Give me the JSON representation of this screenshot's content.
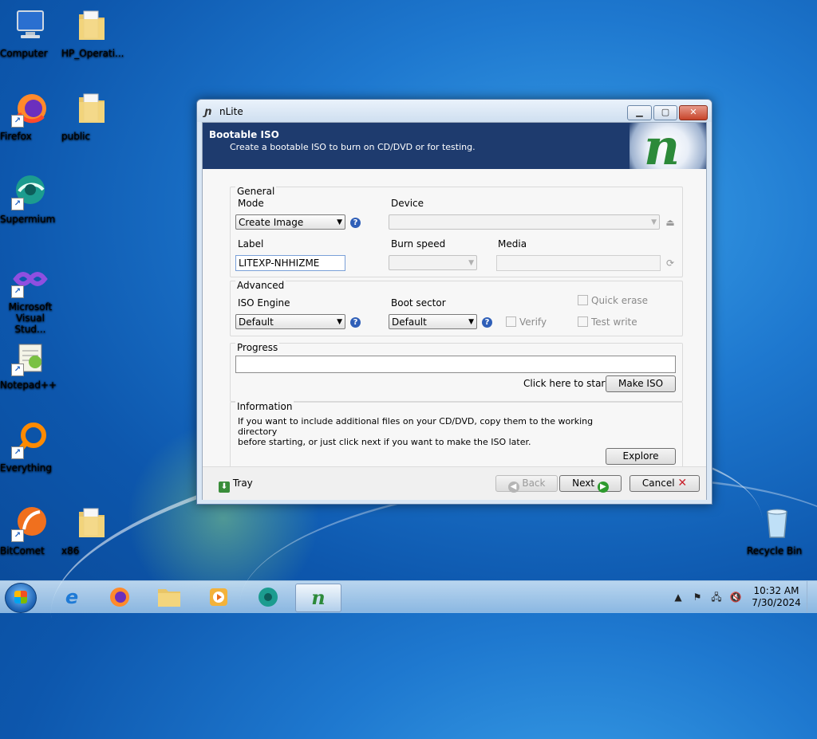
{
  "desktop": {
    "icons": [
      {
        "label": "Computer"
      },
      {
        "label": "HP_Operati..."
      },
      {
        "label": "Firefox"
      },
      {
        "label": "public"
      },
      {
        "label": "Supermium"
      },
      {
        "label": "Microsoft Visual Stud..."
      },
      {
        "label": "Notepad++"
      },
      {
        "label": "Everything"
      },
      {
        "label": "BitComet"
      },
      {
        "label": "x86"
      },
      {
        "label": "Recycle Bin"
      }
    ]
  },
  "window": {
    "title": "nLite",
    "header": {
      "title": "Bootable ISO",
      "subtitle": "Create a bootable ISO to burn on CD/DVD or for testing."
    },
    "general": {
      "legend": "General",
      "mode_label": "Mode",
      "mode_value": "Create Image",
      "device_label": "Device",
      "device_value": "",
      "label_label": "Label",
      "label_value": "LITEXP-NHHIZME",
      "burn_speed_label": "Burn speed",
      "burn_speed_value": "",
      "media_label": "Media",
      "media_value": ""
    },
    "advanced": {
      "legend": "Advanced",
      "iso_engine_label": "ISO Engine",
      "iso_engine_value": "Default",
      "boot_sector_label": "Boot sector",
      "boot_sector_value": "Default",
      "verify_label": "Verify",
      "quick_erase_label": "Quick erase",
      "test_write_label": "Test write"
    },
    "progress": {
      "legend": "Progress",
      "hint": "Click here to start ->",
      "make_iso_label": "Make ISO"
    },
    "information": {
      "legend": "Information",
      "line1": "If you want to include additional files on your CD/DVD, copy them to the working directory",
      "line2": "before starting, or just click next if you want to make the ISO later.",
      "explore_label": "Explore"
    },
    "footer": {
      "tray_label": "Tray",
      "back_label": "Back",
      "next_label": "Next",
      "cancel_label": "Cancel"
    }
  },
  "taskbar": {
    "clock_time": "10:32 AM",
    "clock_date": "7/30/2024"
  }
}
